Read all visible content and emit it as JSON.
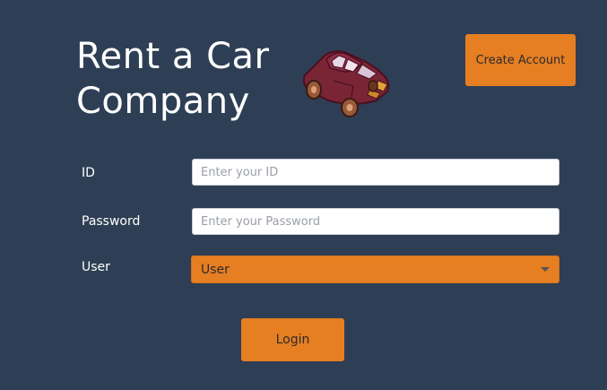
{
  "header": {
    "title_line1": "Rent a Car",
    "title_line2": "Company",
    "logo_icon": "car-icon"
  },
  "toolbar": {
    "create_account_label": "Create Account"
  },
  "form": {
    "id_label": "ID",
    "id_placeholder": "Enter your ID",
    "id_value": "",
    "password_label": "Password",
    "password_placeholder": "Enter your Password",
    "password_value": "",
    "role_label": "User",
    "role_selected": "User",
    "login_label": "Login"
  },
  "colors": {
    "background": "#2e3f55",
    "accent": "#e67e22",
    "text": "#ffffff"
  }
}
